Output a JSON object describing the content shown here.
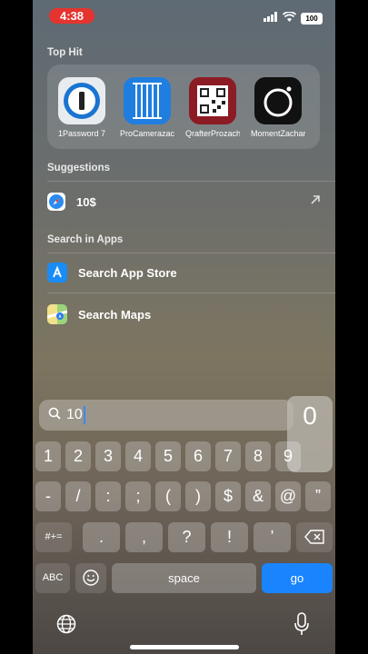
{
  "status_bar": {
    "time": "4:38",
    "battery": "100",
    "icons": [
      "signal-icon",
      "wifi-icon",
      "battery-icon"
    ]
  },
  "sections": {
    "top_hit": "Top Hit",
    "suggestions": "Suggestions",
    "search_in_apps": "Search in Apps"
  },
  "top_hits": [
    {
      "name": "1Password 7",
      "icon": "1password-icon"
    },
    {
      "name": "ProCamerazac…",
      "icon": "procamera-icon"
    },
    {
      "name": "QrafterProzach…",
      "icon": "qrafter-icon"
    },
    {
      "name": "MomentZachar…",
      "icon": "moment-icon"
    }
  ],
  "suggestions": [
    {
      "text": "10$",
      "icon": "safari-icon"
    }
  ],
  "app_searches": [
    {
      "text": "Search App Store",
      "icon": "app-store-icon"
    },
    {
      "text": "Search Maps",
      "icon": "maps-icon"
    }
  ],
  "search": {
    "query": "10"
  },
  "key_popup": {
    "char": "0"
  },
  "keyboard": {
    "row1": [
      "1",
      "2",
      "3",
      "4",
      "5",
      "6",
      "7",
      "8",
      "9"
    ],
    "row2": [
      "-",
      "/",
      ":",
      ";",
      "(",
      ")",
      "$",
      "&",
      "@",
      "”"
    ],
    "row3_left": "#+=",
    "row3": [
      ".",
      ",",
      "?",
      "!",
      "’"
    ],
    "row4": {
      "abc": "ABC",
      "space": "space",
      "go": "go"
    }
  },
  "colors": {
    "accent": "#1a84ff",
    "time_pill": "#e5342f"
  }
}
